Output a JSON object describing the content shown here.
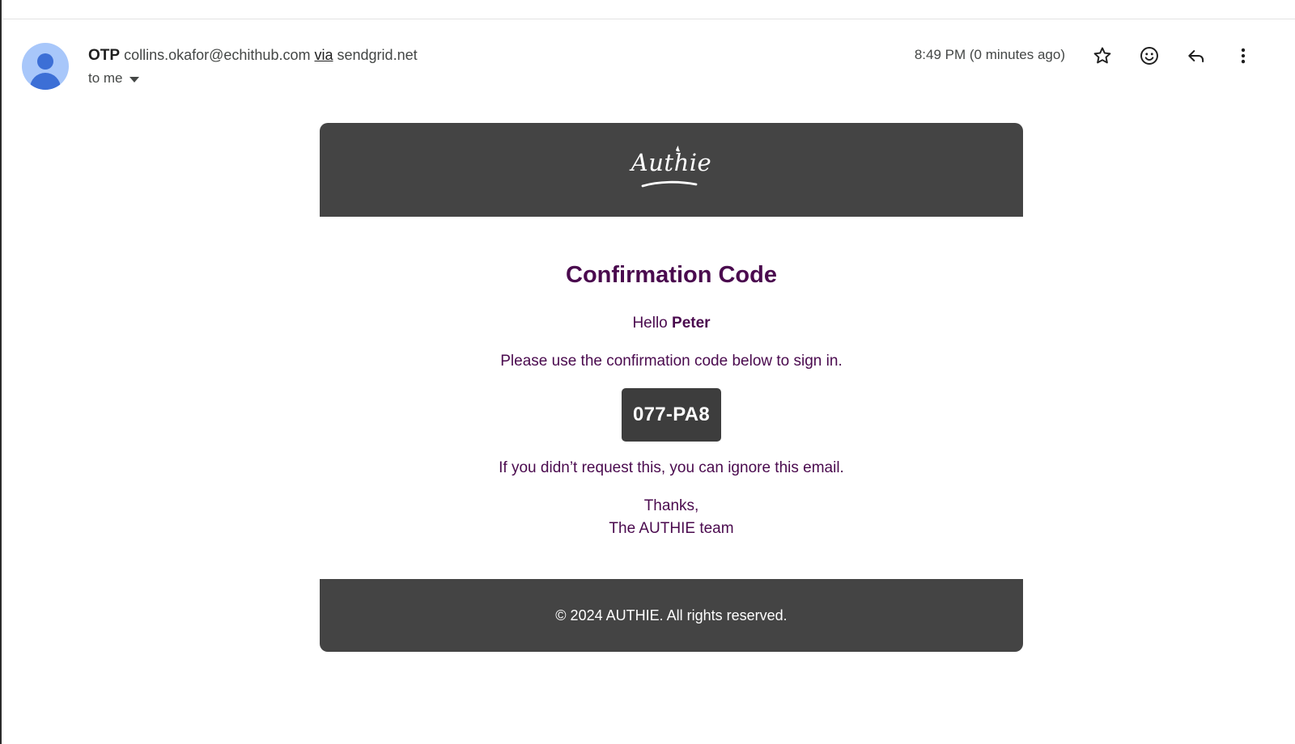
{
  "message_header": {
    "sender_name": "OTP",
    "sender_email": "collins.okafor@echithub.com",
    "via_label": "via",
    "via_domain": "sendgrid.net",
    "recipient_label": "to me",
    "timestamp": "8:49 PM (0 minutes ago)",
    "actions": [
      "star-icon",
      "emoji-reaction-icon",
      "reply-icon",
      "more-options-icon"
    ]
  },
  "email_body": {
    "logo_text": "Authie",
    "title": "Confirmation Code",
    "greeting_prefix": "Hello",
    "greeting_name": "Peter",
    "instruction": "Please use the confirmation code below to sign in.",
    "code": "077-PA8",
    "ignore_notice": "If you didn’t request this, you can ignore this email.",
    "closing": "Thanks,",
    "signature": "The AUTHIE team",
    "footer": "© 2024 AUTHIE. All rights reserved."
  },
  "colors": {
    "brand_dark": "#444444",
    "text_purple": "#4a0a4e",
    "avatar_bg": "#a8c7fa",
    "avatar_fg": "#3c6fd6"
  }
}
